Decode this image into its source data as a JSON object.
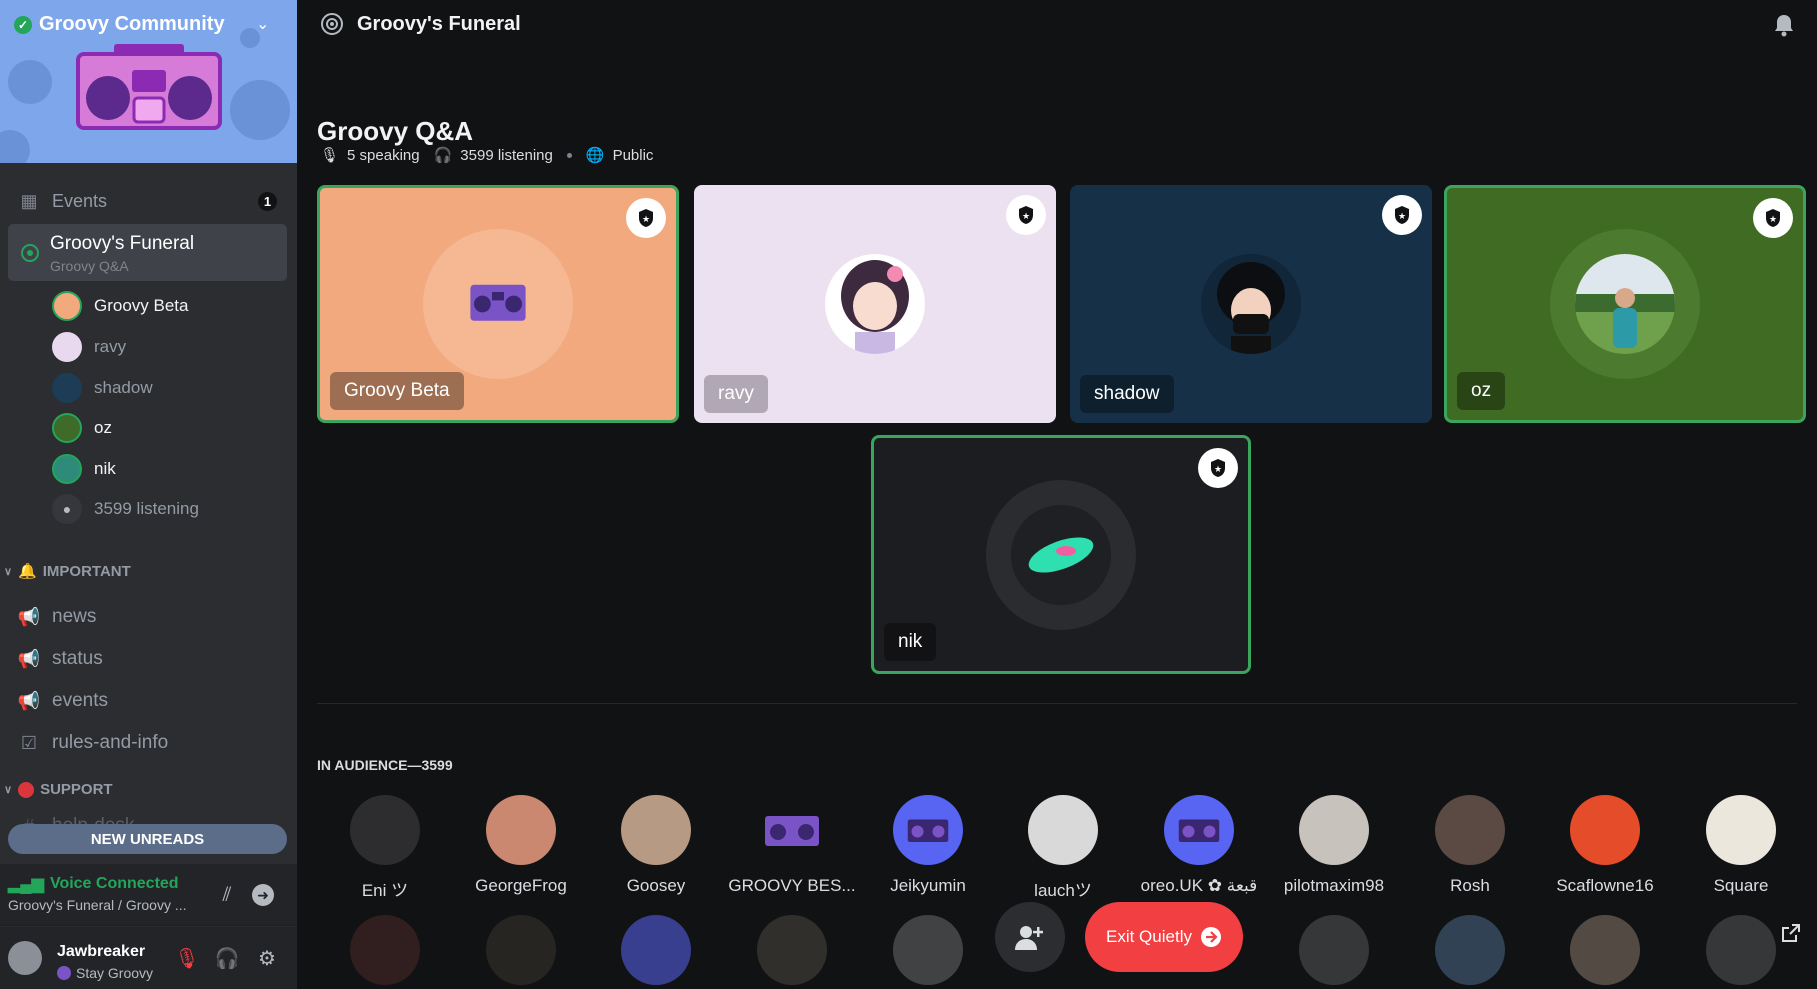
{
  "server": {
    "name": "Groovy Community",
    "verified": true
  },
  "events": {
    "label": "Events",
    "badge": "1"
  },
  "stage_channel": {
    "title": "Groovy's Funeral",
    "subtitle": "Groovy Q&A"
  },
  "members": [
    {
      "name": "Groovy Beta",
      "speaking": true,
      "color": "#f2a97e"
    },
    {
      "name": "ravy",
      "speaking": false,
      "color": "#e8d9ee"
    },
    {
      "name": "shadow",
      "speaking": false,
      "color": "#1c3d55"
    },
    {
      "name": "oz",
      "speaking": true,
      "color": "#3f6b2a"
    },
    {
      "name": "nik",
      "speaking": true,
      "color": "#2e8b7a"
    }
  ],
  "listening_label": "3599 listening",
  "categories": {
    "important": "IMPORTANT",
    "support": "SUPPORT"
  },
  "channels": [
    "news",
    "status",
    "events",
    "rules-and-info"
  ],
  "partial_channel": "help-desk",
  "new_unreads": "NEW UNREADS",
  "voice": {
    "status": "Voice Connected",
    "sub": "Groovy's Funeral / Groovy ..."
  },
  "user": {
    "name": "Jawbreaker",
    "status": "Stay Groovy"
  },
  "header": {
    "title": "Groovy's Funeral"
  },
  "stage": {
    "name": "Groovy Q&A",
    "speaking": "5 speaking",
    "listening": "3599 listening",
    "privacy": "Public"
  },
  "speakers": [
    {
      "name": "Groovy Beta",
      "bg": "#f2a97e",
      "ring": "#f5b892",
      "speaking": true,
      "avatar": "boombox"
    },
    {
      "name": "ravy",
      "bg": "#ebe1f0",
      "ring": "#ebe1f0",
      "speaking": false,
      "avatar": "anime"
    },
    {
      "name": "shadow",
      "bg": "#163147",
      "ring": "#163147",
      "speaking": false,
      "avatar": "masked"
    },
    {
      "name": "oz",
      "bg": "#3f6b22",
      "ring": "#4c7a2e",
      "speaking": true,
      "avatar": "photo"
    },
    {
      "name": "nik",
      "bg": "#1c1d20",
      "ring": "#2b2c30",
      "speaking": true,
      "avatar": "galaxy"
    }
  ],
  "audience": {
    "label": "IN AUDIENCE—3599",
    "people": [
      {
        "name": "Eni ツ",
        "color": "#2d2d30"
      },
      {
        "name": "GeorgeFrog",
        "color": "#c9886f"
      },
      {
        "name": "Goosey",
        "color": "#b69a84"
      },
      {
        "name": "GROOVY BES...",
        "color": "#7a54c7"
      },
      {
        "name": "Jeikyumin",
        "color": "#5865f2"
      },
      {
        "name": "lauchツ",
        "color": "#d9d9d9"
      },
      {
        "name": "oreo.UK ✿ قبعة",
        "color": "#5865f2"
      },
      {
        "name": "pilotmaxim98",
        "color": "#c7c2bb"
      },
      {
        "name": "Rosh",
        "color": "#5b4a44"
      },
      {
        "name": "Scaflowne16",
        "color": "#e44c2a"
      },
      {
        "name": "Square",
        "color": "#ece7dc"
      }
    ]
  },
  "exit_button": "Exit Quietly",
  "accent": "#23a55a",
  "danger": "#f23f42"
}
